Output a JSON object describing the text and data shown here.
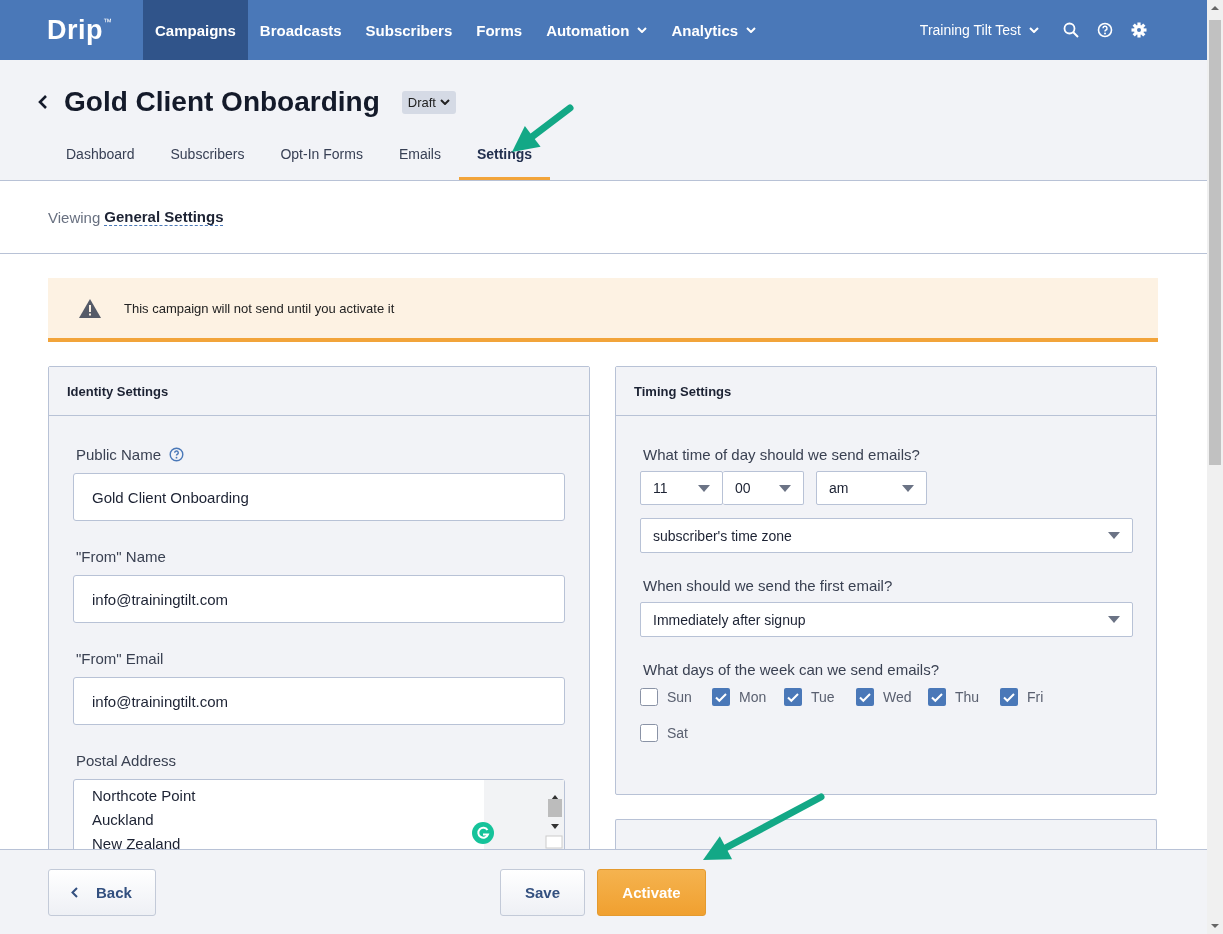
{
  "nav": {
    "logo": "Drip",
    "logo_mark": "™",
    "items": [
      {
        "label": "Campaigns",
        "selected": true,
        "dropdown": false
      },
      {
        "label": "Broadcasts",
        "selected": false,
        "dropdown": false
      },
      {
        "label": "Subscribers",
        "selected": false,
        "dropdown": false
      },
      {
        "label": "Forms",
        "selected": false,
        "dropdown": false
      },
      {
        "label": "Automation",
        "selected": false,
        "dropdown": true
      },
      {
        "label": "Analytics",
        "selected": false,
        "dropdown": true
      }
    ],
    "account": "Training Tilt Test"
  },
  "header": {
    "title": "Gold Client Onboarding",
    "status": "Draft"
  },
  "tabs": [
    {
      "label": "Dashboard",
      "selected": false
    },
    {
      "label": "Subscribers",
      "selected": false
    },
    {
      "label": "Opt-In Forms",
      "selected": false
    },
    {
      "label": "Emails",
      "selected": false
    },
    {
      "label": "Settings",
      "selected": true
    }
  ],
  "viewing": {
    "prefix": "Viewing",
    "value": "General Settings"
  },
  "alert": {
    "text": "This campaign will not send until you activate it"
  },
  "identity": {
    "title": "Identity Settings",
    "fields": [
      {
        "label": "Public Name",
        "help": true,
        "value": "Gold Client Onboarding"
      },
      {
        "label": "\"From\" Name",
        "help": false,
        "value": "info@trainingtilt.com"
      },
      {
        "label": "\"From\" Email",
        "help": false,
        "value": "info@trainingtilt.com"
      }
    ],
    "postal": {
      "label": "Postal Address",
      "value": "Northcote Point\nAuckland\nNew Zealand"
    }
  },
  "timing": {
    "title": "Timing Settings",
    "time_question": "What time of day should we send emails?",
    "hour": "11",
    "minute": "00",
    "meridiem": "am",
    "timezone": "subscriber's time zone",
    "first_question": "When should we send the first email?",
    "first": "Immediately after signup",
    "days_question": "What days of the week can we send emails?",
    "days": [
      {
        "label": "Sun",
        "checked": false
      },
      {
        "label": "Mon",
        "checked": true
      },
      {
        "label": "Tue",
        "checked": true
      },
      {
        "label": "Wed",
        "checked": true
      },
      {
        "label": "Thu",
        "checked": true
      },
      {
        "label": "Fri",
        "checked": true
      },
      {
        "label": "Sat",
        "checked": false
      }
    ]
  },
  "footer": {
    "back": "Back",
    "save": "Save",
    "activate": "Activate"
  }
}
